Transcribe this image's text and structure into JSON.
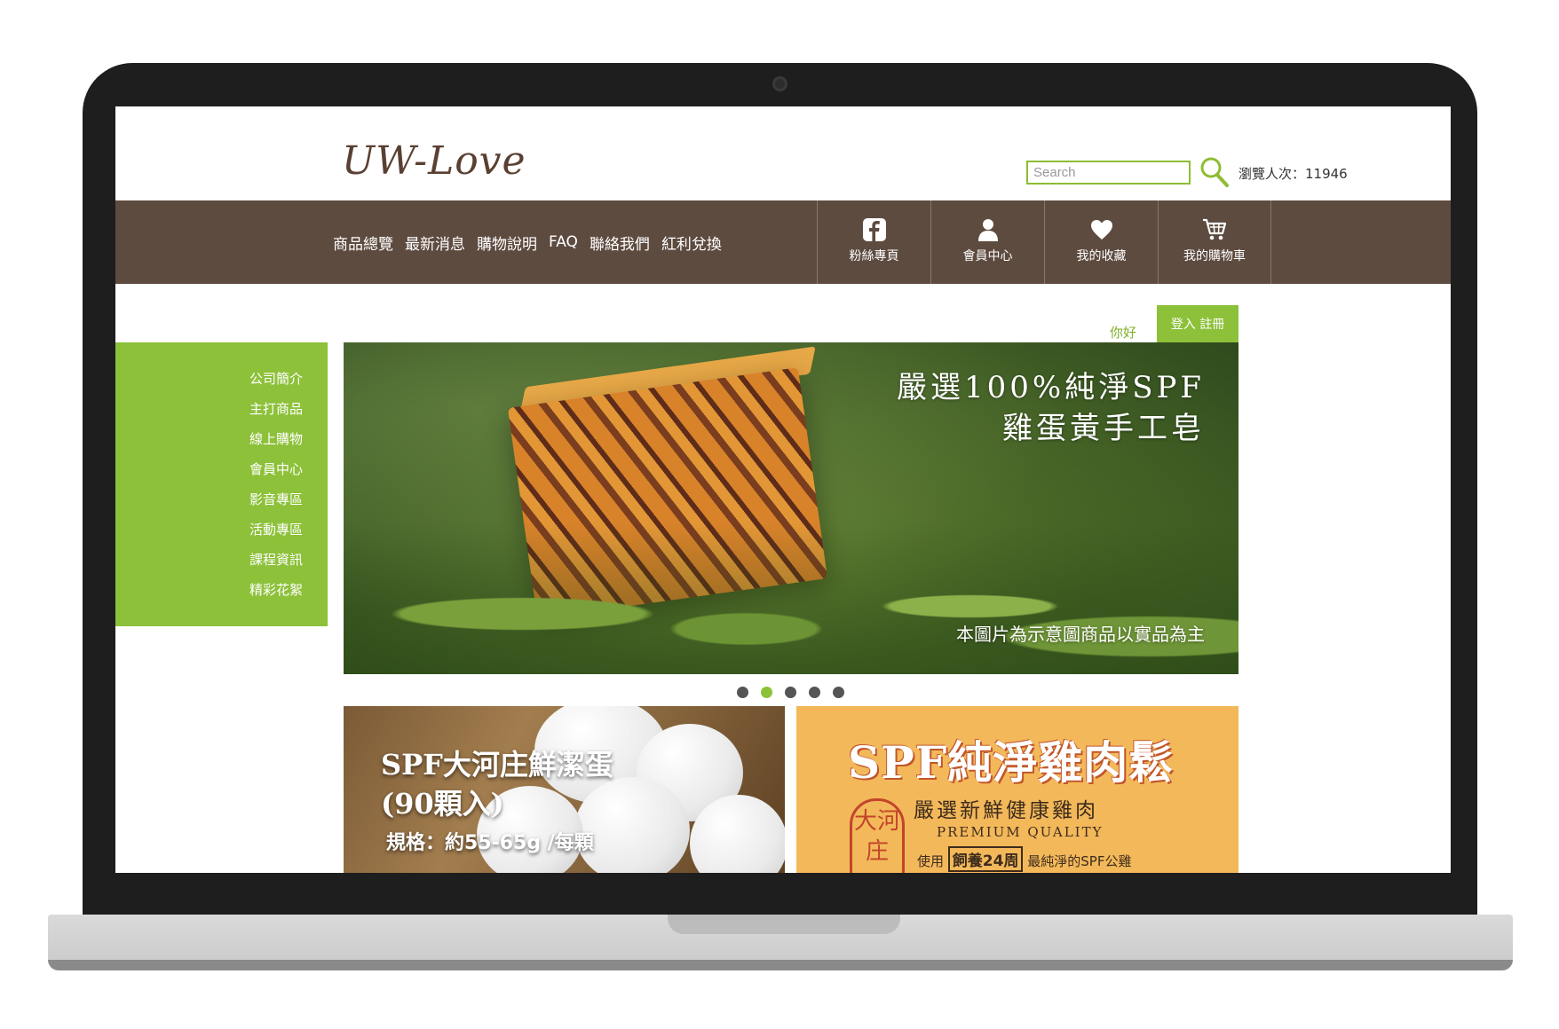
{
  "header": {
    "logo": "UW-Love",
    "search_placeholder": "Search",
    "visits_label": "瀏覽人次：11946"
  },
  "nav": {
    "links": [
      "商品總覽",
      "最新消息",
      "購物說明",
      "FAQ",
      "聯絡我們",
      "紅利兌換"
    ],
    "boxes": [
      {
        "label": "粉絲專頁",
        "icon": "facebook-icon"
      },
      {
        "label": "會員中心",
        "icon": "user-icon"
      },
      {
        "label": "我的收藏",
        "icon": "heart-icon"
      },
      {
        "label": "我的購物車",
        "icon": "cart-icon"
      }
    ]
  },
  "greeting": {
    "hello": "你好",
    "login_register": "登入 註冊"
  },
  "sidebar": {
    "items": [
      "公司簡介",
      "主打商品",
      "線上購物",
      "會員中心",
      "影音專區",
      "活動專區",
      "課程資訊",
      "精彩花絮"
    ]
  },
  "banner": {
    "title_line1": "嚴選100%純淨SPF",
    "title_line2": "雞蛋黃手工皂",
    "note": "本圖片為示意圖商品以實品為主",
    "slide_count": 5,
    "active_slide": 2
  },
  "promos": {
    "eggs": {
      "title_line1": "SPF大河庄鮮潔蛋",
      "title_line2": "(90顆入)",
      "spec": "規格：約55-65g /每顆"
    },
    "floss": {
      "title": "SPF純淨雞肉鬆",
      "subtitle": "嚴選新鮮健康雞肉",
      "quality": "PREMIUM QUALITY",
      "line_prefix": "使用",
      "line_box": "飼養24周",
      "line_suffix": "最純淨的SPF公雞",
      "seal": "大河庄"
    }
  },
  "colors": {
    "nav_brown": "#5e4b40",
    "accent_green": "#8dc13a",
    "logo_brown": "#5a4032"
  }
}
